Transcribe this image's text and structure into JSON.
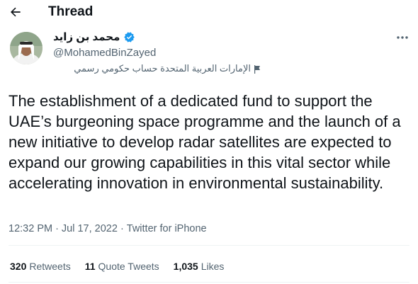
{
  "header": {
    "title": "Thread"
  },
  "author": {
    "name": "محمد بن زايد",
    "handle": "@MohamedBinZayed",
    "label": "الإمارات العربية المتحدة حساب حكومي رسمي",
    "verified_color": "#1d9bf0"
  },
  "tweet": {
    "text": "The establishment of a dedicated fund to support the UAE’s burgeoning space programme and the launch of a new initiative to develop radar satellites are expected to expand our growing capabilities in this vital sector while accelerating innovation in environmental sustainability.",
    "time": "12:32 PM",
    "separator": "·",
    "date": "Jul 17, 2022",
    "source": "Twitter for iPhone"
  },
  "stats": {
    "retweets_count": "320",
    "retweets_label": "Retweets",
    "quotes_count": "11",
    "quotes_label": "Quote Tweets",
    "likes_count": "1,035",
    "likes_label": "Likes"
  },
  "icons": {
    "back": "back-arrow-icon",
    "more": "more-icon",
    "verified": "verified-badge-icon",
    "flag": "flag-icon"
  }
}
